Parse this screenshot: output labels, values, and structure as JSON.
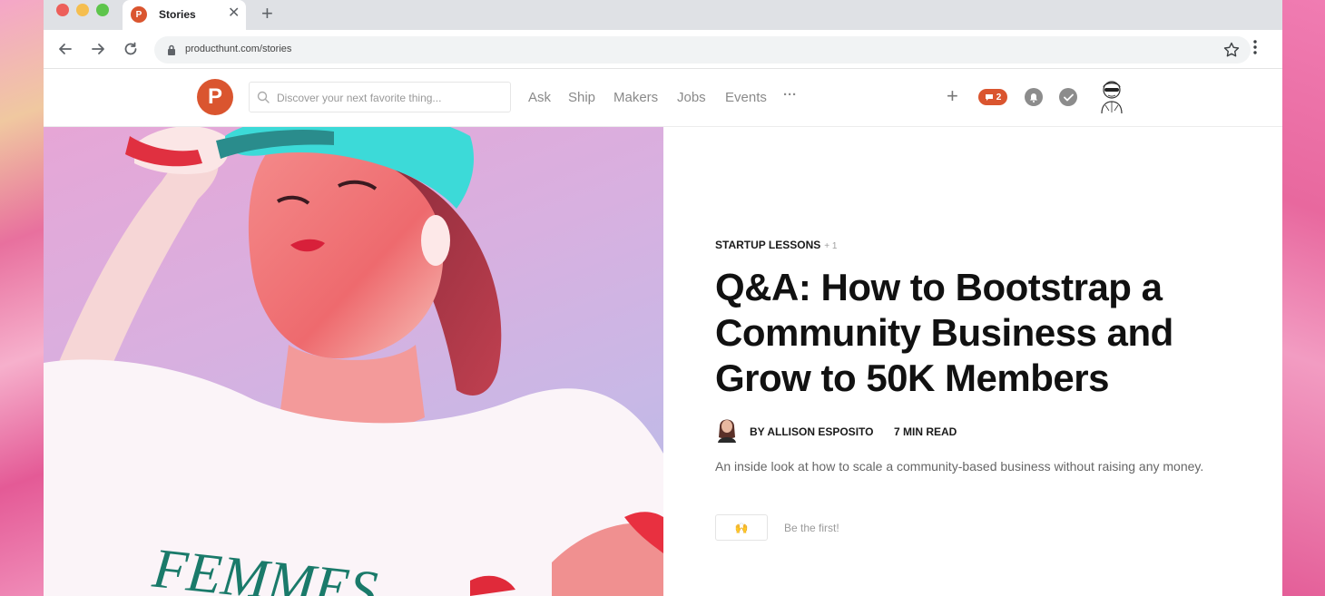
{
  "browser": {
    "tab_favicon": "P",
    "tab_title": "Stories",
    "tab_close": "✕",
    "new_tab": "+",
    "url": "producthunt.com/stories"
  },
  "header": {
    "logo_letter": "P",
    "search_placeholder": "Discover your next favorite thing...",
    "nav": [
      "Ask",
      "Ship",
      "Makers",
      "Jobs",
      "Events"
    ],
    "more": "···",
    "plus": "+",
    "notification_count": "2"
  },
  "article": {
    "topic": "STARTUP LESSONS",
    "topic_extra": "+ 1",
    "headline": "Q&A: How to Bootstrap a Community Business and Grow to 50K Members",
    "author": "BY ALLISON ESPOSITO",
    "read_time": "7 MIN READ",
    "description": "An inside look at how to scale a community-based business without raising any money.",
    "reaction_emoji": "🙌",
    "be_first": "Be the first!"
  },
  "hero": {
    "shirt_text": "FEMMES"
  },
  "colors": {
    "brand": "#da552f",
    "background": "#e8609c"
  }
}
